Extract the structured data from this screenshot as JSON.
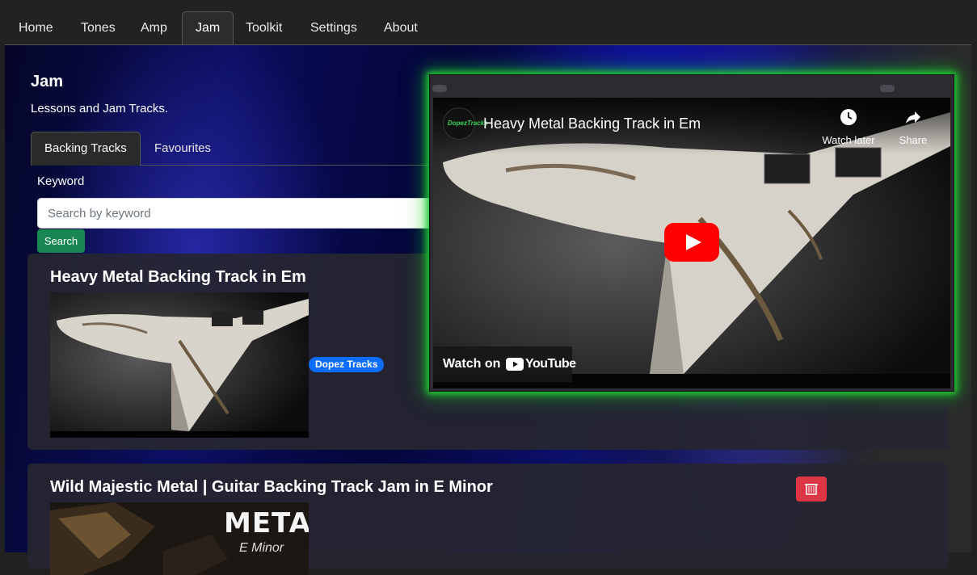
{
  "nav": {
    "items": [
      {
        "label": "Home"
      },
      {
        "label": "Tones"
      },
      {
        "label": "Amp"
      },
      {
        "label": "Jam"
      },
      {
        "label": "Toolkit"
      },
      {
        "label": "Settings"
      },
      {
        "label": "About"
      }
    ],
    "active": "Jam"
  },
  "page": {
    "title": "Jam",
    "subtitle": "Lessons and Jam Tracks."
  },
  "tabs": [
    {
      "label": "Backing Tracks",
      "active": true
    },
    {
      "label": "Favourites",
      "active": false
    }
  ],
  "search": {
    "label": "Keyword",
    "placeholder": "Search by keyword",
    "value": "",
    "button_label": "Search"
  },
  "tracks": [
    {
      "title": "Heavy Metal Backing Track in Em",
      "channel_badge": "Dopez Tracks"
    },
    {
      "title": "Wild Majestic Metal | Guitar Backing Track Jam in E Minor",
      "thumbnail_text": "METAL",
      "thumbnail_subtext": "E Minor"
    }
  ],
  "video": {
    "title": "Heavy Metal Backing Track in Em",
    "channel_logo_text": "DopezTracks",
    "watch_later_label": "Watch later",
    "share_label": "Share",
    "watch_on_label": "Watch on",
    "platform_label": "YouTube"
  },
  "colors": {
    "search_button": "#198754",
    "badge": "#0d6efd",
    "delete_button": "#dc3545",
    "video_glow": "#22cc33",
    "play_button": "#ff0000"
  },
  "icons": {
    "delete": "trash-icon",
    "watch_later": "clock-icon",
    "share": "share-arrow-icon",
    "play": "play-icon"
  }
}
